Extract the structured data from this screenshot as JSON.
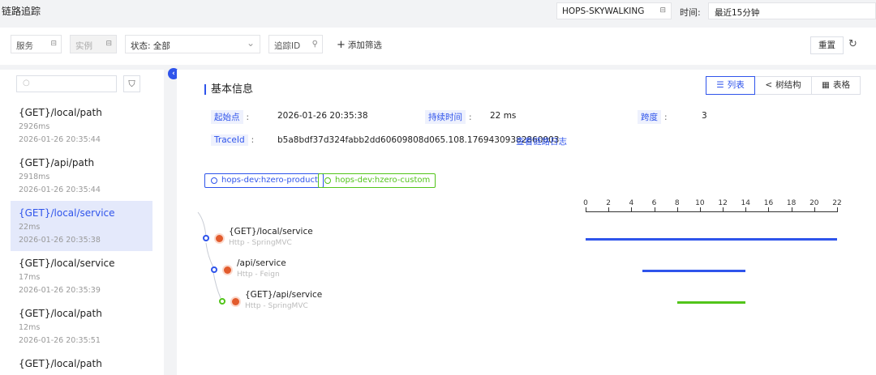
{
  "header": {
    "title": "链路追踪",
    "env_select": "HOPS-SKYWALKING",
    "time_label": "时间:",
    "time_value": "最近15分钟"
  },
  "filters": {
    "service": "服务",
    "instance": "实例",
    "status": "状态: 全部",
    "trace_id": "追踪ID",
    "add_filter": "添加筛选",
    "reset": "重置"
  },
  "trace_list": [
    {
      "name": "{GET}/local/path",
      "duration": "2926ms",
      "time": "2026-01-26 20:35:44"
    },
    {
      "name": "{GET}/api/path",
      "duration": "2918ms",
      "time": "2026-01-26 20:35:44"
    },
    {
      "name": "{GET}/local/service",
      "duration": "22ms",
      "time": "2026-01-26 20:35:38"
    },
    {
      "name": "{GET}/local/service",
      "duration": "17ms",
      "time": "2026-01-26 20:35:39"
    },
    {
      "name": "{GET}/local/path",
      "duration": "12ms",
      "time": "2026-01-26 20:35:51"
    },
    {
      "name": "{GET}/local/path",
      "duration": "",
      "time": ""
    }
  ],
  "detail": {
    "section_title": "基本信息",
    "view_tabs": [
      "列表",
      "树结构",
      "表格"
    ],
    "start_label": "起始点",
    "start_value": "2026-01-26 20:35:38",
    "duration_label": "持续时间",
    "duration_value": "22 ms",
    "span_label": "跨度",
    "span_value": "3",
    "traceid_label": "TraceId",
    "traceid_value": "b5a8bdf37d324fabb2dd60609808d065.108.17694309382860003",
    "log_link": "查看链路日志",
    "services": [
      {
        "name": "hops-dev:hzero-product",
        "color": "#2f54eb"
      },
      {
        "name": "hops-dev:hzero-custom",
        "color": "#52c41a"
      }
    ]
  },
  "timeline": {
    "ticks": [
      "0",
      "2",
      "4",
      "6",
      "8",
      "10",
      "12",
      "14",
      "16",
      "18",
      "20",
      "22"
    ],
    "max": 22,
    "spans": [
      {
        "name": "{GET}/local/service",
        "type": "Http - SpringMVC",
        "start": 0,
        "end": 22,
        "color": "#2f54eb"
      },
      {
        "name": "/api/service",
        "type": "Http - Feign",
        "start": 5,
        "end": 14,
        "color": "#2f54eb"
      },
      {
        "name": "{GET}/api/service",
        "type": "Http - SpringMVC",
        "start": 8,
        "end": 14,
        "color": "#52c41a"
      }
    ]
  }
}
